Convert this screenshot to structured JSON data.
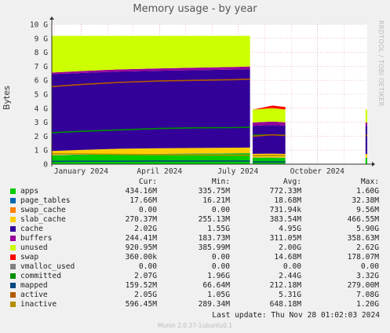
{
  "title": "Memory usage - by year",
  "ylabel": "Bytes",
  "side_label": "RRDTOOL / TOBI OETIKER",
  "legend_header": {
    "cur": "Cur:",
    "min": "Min:",
    "avg": "Avg:",
    "max": "Max:"
  },
  "legend": [
    {
      "name": "apps",
      "color": "#00cc00",
      "cur": "434.16M",
      "min": "335.75M",
      "avg": "772.33M",
      "max": "1.60G"
    },
    {
      "name": "page_tables",
      "color": "#0066b3",
      "cur": "17.66M",
      "min": "16.21M",
      "avg": "18.68M",
      "max": "32.38M"
    },
    {
      "name": "swap_cache",
      "color": "#ff8000",
      "cur": "0.00",
      "min": "0.00",
      "avg": "731.94k",
      "max": "9.56M"
    },
    {
      "name": "slab_cache",
      "color": "#ffcc00",
      "cur": "270.37M",
      "min": "255.13M",
      "avg": "383.54M",
      "max": "466.55M"
    },
    {
      "name": "cache",
      "color": "#330099",
      "cur": "2.02G",
      "min": "1.55G",
      "avg": "4.95G",
      "max": "5.90G"
    },
    {
      "name": "buffers",
      "color": "#990099",
      "cur": "244.41M",
      "min": "183.73M",
      "avg": "311.05M",
      "max": "358.63M"
    },
    {
      "name": "unused",
      "color": "#ccff00",
      "cur": "920.95M",
      "min": "385.99M",
      "avg": "2.00G",
      "max": "2.62G"
    },
    {
      "name": "swap",
      "color": "#ff0000",
      "cur": "360.00k",
      "min": "0.00",
      "avg": "14.68M",
      "max": "178.07M"
    },
    {
      "name": "vmalloc_used",
      "color": "#808080",
      "cur": "0.00",
      "min": "0.00",
      "avg": "0.00",
      "max": "0.00"
    },
    {
      "name": "committed",
      "color": "#008f00",
      "cur": "2.07G",
      "min": "1.96G",
      "avg": "2.44G",
      "max": "3.32G"
    },
    {
      "name": "mapped",
      "color": "#00487d",
      "cur": "159.52M",
      "min": "66.64M",
      "avg": "212.18M",
      "max": "279.00M"
    },
    {
      "name": "active",
      "color": "#b35a00",
      "cur": "2.05G",
      "min": "1.05G",
      "avg": "5.31G",
      "max": "7.08G"
    },
    {
      "name": "inactive",
      "color": "#b38f00",
      "cur": "596.45M",
      "min": "289.34M",
      "avg": "648.18M",
      "max": "1.20G"
    }
  ],
  "last_update": "Last update: Thu Nov 28 01:02:03 2024",
  "footer": "Munin 2.0.37-1ubuntu0.1",
  "chart_data": {
    "type": "area",
    "title": "Memory usage - by year",
    "ylabel": "Bytes",
    "ylim": [
      0,
      10
    ],
    "y_unit": "G",
    "yticks": [
      "0",
      "1 G",
      "2 G",
      "3 G",
      "4 G",
      "5 G",
      "6 G",
      "7 G",
      "8 G",
      "9 G",
      "10 G"
    ],
    "x_range": [
      "2023-11-28",
      "2024-11-28"
    ],
    "xticks": [
      {
        "date": "2024-01-01",
        "label": "January 2024"
      },
      {
        "date": "2024-04-01",
        "label": "April 2024"
      },
      {
        "date": "2024-07-01",
        "label": "July 2024"
      },
      {
        "date": "2024-10-01",
        "label": "October 2024"
      }
    ],
    "grid": true,
    "segments": [
      {
        "x": [
          "2023-11-28",
          "2024-01-01",
          "2024-02-15",
          "2024-04-01",
          "2024-05-15",
          "2024-07-01",
          "2024-07-15"
        ],
        "series": [
          {
            "name": "apps",
            "values": [
              0.62,
              0.66,
              0.7,
              0.72,
              0.74,
              0.76,
              0.77
            ]
          },
          {
            "name": "page_tables",
            "values": [
              0.02,
              0.02,
              0.02,
              0.02,
              0.02,
              0.02,
              0.02
            ]
          },
          {
            "name": "swap_cache",
            "values": [
              0.0,
              0.0,
              0.0,
              0.0,
              0.0,
              0.0,
              0.0
            ]
          },
          {
            "name": "slab_cache",
            "values": [
              0.3,
              0.34,
              0.38,
              0.4,
              0.4,
              0.4,
              0.4
            ]
          },
          {
            "name": "cache",
            "values": [
              5.49,
              5.5,
              5.52,
              5.54,
              5.56,
              5.59,
              5.61
            ]
          },
          {
            "name": "buffers",
            "values": [
              0.12,
              0.14,
              0.16,
              0.17,
              0.18,
              0.19,
              0.19
            ]
          },
          {
            "name": "unused",
            "values": [
              2.63,
              2.52,
              2.4,
              2.33,
              2.28,
              2.22,
              2.19
            ]
          }
        ],
        "lines": [
          {
            "name": "committed",
            "values": [
              2.25,
              2.35,
              2.45,
              2.55,
              2.6,
              2.62,
              2.65
            ]
          },
          {
            "name": "mapped",
            "values": [
              0.2,
              0.21,
              0.21,
              0.22,
              0.22,
              0.22,
              0.22
            ]
          },
          {
            "name": "active",
            "values": [
              5.55,
              5.7,
              5.85,
              5.95,
              6.0,
              6.05,
              6.08
            ]
          },
          {
            "name": "inactive",
            "values": [
              0.75,
              0.73,
              0.7,
              0.68,
              0.66,
              0.64,
              0.63
            ]
          }
        ]
      },
      {
        "x": [
          "2024-07-18",
          "2024-08-10",
          "2024-08-25"
        ],
        "series": [
          {
            "name": "apps",
            "values": [
              0.45,
              0.45,
              0.44
            ]
          },
          {
            "name": "page_tables",
            "values": [
              0.02,
              0.02,
              0.02
            ]
          },
          {
            "name": "swap_cache",
            "values": [
              0.0,
              0.0,
              0.0
            ]
          },
          {
            "name": "slab_cache",
            "values": [
              0.27,
              0.28,
              0.27
            ]
          },
          {
            "name": "cache",
            "values": [
              2.0,
              2.05,
              2.02
            ]
          },
          {
            "name": "buffers",
            "values": [
              0.24,
              0.25,
              0.24
            ]
          },
          {
            "name": "unused",
            "values": [
              0.92,
              0.96,
              0.92
            ]
          },
          {
            "name": "swap",
            "values": [
              0.0,
              0.18,
              0.18
            ]
          }
        ],
        "lines": [
          {
            "name": "committed",
            "values": [
              2.07,
              2.1,
              2.07
            ]
          },
          {
            "name": "mapped",
            "values": [
              0.16,
              0.16,
              0.16
            ]
          },
          {
            "name": "active",
            "values": [
              2.0,
              2.1,
              2.05
            ]
          },
          {
            "name": "inactive",
            "values": [
              0.6,
              0.62,
              0.6
            ]
          }
        ]
      },
      {
        "x": [
          "2024-11-26",
          "2024-11-28"
        ],
        "series": [
          {
            "name": "apps",
            "values": [
              0.43,
              0.43
            ]
          },
          {
            "name": "page_tables",
            "values": [
              0.02,
              0.02
            ]
          },
          {
            "name": "swap_cache",
            "values": [
              0.0,
              0.0
            ]
          },
          {
            "name": "slab_cache",
            "values": [
              0.27,
              0.27
            ]
          },
          {
            "name": "cache",
            "values": [
              2.02,
              2.02
            ]
          },
          {
            "name": "buffers",
            "values": [
              0.24,
              0.24
            ]
          },
          {
            "name": "unused",
            "values": [
              0.92,
              0.92
            ]
          }
        ],
        "lines": [
          {
            "name": "committed",
            "values": [
              2.07,
              2.07
            ]
          },
          {
            "name": "active",
            "values": [
              2.05,
              2.05
            ]
          }
        ]
      }
    ]
  }
}
